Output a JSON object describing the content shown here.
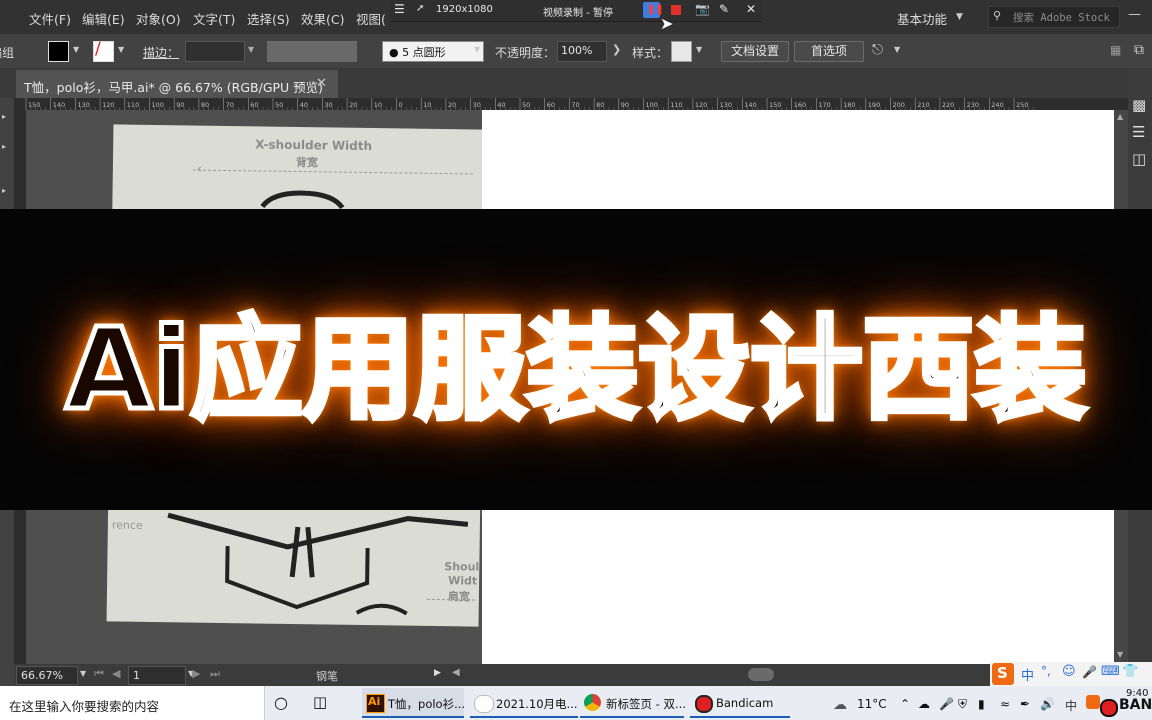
{
  "menu": {
    "items": [
      "文件(F)",
      "编辑(E)",
      "对象(O)",
      "文字(T)",
      "选择(S)",
      "效果(C)",
      "视图("
    ],
    "workspace": "基本功能",
    "stock_placeholder": "搜索 Adobe Stock"
  },
  "recorder": {
    "resolution": "1920x1080",
    "status": "视频录制 - 暂停"
  },
  "control_bar": {
    "left_label": "编组",
    "stroke_label": "描边：",
    "brush_value": "5 点圆形",
    "opacity_label": "不透明度：",
    "opacity_value": "100%",
    "style_label": "样式：",
    "doc_settings": "文档设置",
    "preferences": "首选项"
  },
  "document": {
    "tab_title": "T恤，polo衫，马甲.ai* @ 66.67% (RGB/GPU 预览)",
    "ruler_labels": [
      "150",
      "140",
      "130",
      "120",
      "110",
      "100",
      "90",
      "80",
      "70",
      "60",
      "50",
      "40",
      "30",
      "20",
      "10",
      "0",
      "10",
      "20",
      "30",
      "40",
      "50",
      "60",
      "70",
      "80",
      "90",
      "100",
      "110",
      "120",
      "130",
      "140",
      "150",
      "160",
      "170",
      "180",
      "190",
      "200",
      "210",
      "220",
      "230",
      "240",
      "250"
    ]
  },
  "photo_text": {
    "x_shoulder": "X-shoulder Width",
    "x_shoulder_cn": "背宽",
    "circumference": "rence",
    "shoulder": "Shoul",
    "width": "Widt",
    "shoulder_cn": "肩宽"
  },
  "status": {
    "zoom": "66.67%",
    "artboard_num": "1",
    "tool": "钢笔"
  },
  "banner": {
    "title": "Ai应用服装设计西装"
  },
  "taskbar": {
    "search_placeholder": "在这里输入你要搜索的内容",
    "apps": [
      {
        "label": "T恤，polo衫..."
      },
      {
        "label": "2021.10月电..."
      },
      {
        "label": "新标签页 - 双..."
      },
      {
        "label": "Bandicam"
      }
    ],
    "temperature": "11°C",
    "ime": "中",
    "time": "9:40",
    "brand": "BAN"
  }
}
